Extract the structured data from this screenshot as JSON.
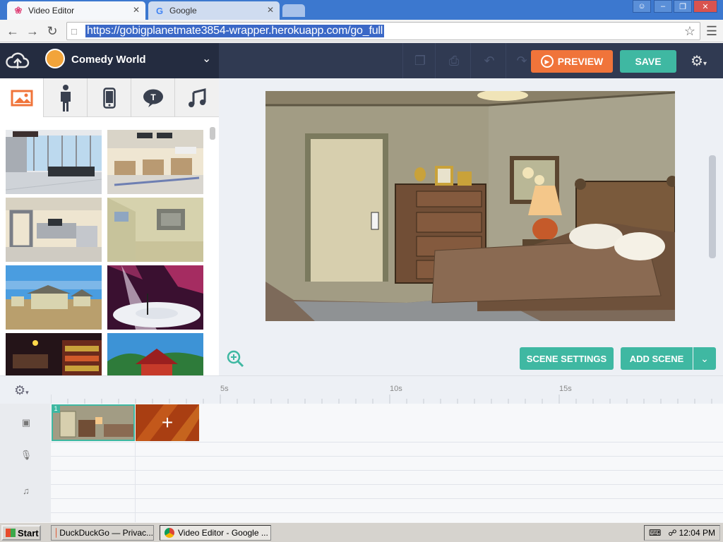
{
  "browser": {
    "tabs": [
      {
        "title": "Video Editor",
        "active": true
      },
      {
        "title": "Google",
        "active": false
      }
    ],
    "url": "https://gobigplanetmate3854-wrapper.herokuapp.com/go_full"
  },
  "editor": {
    "project_title": "Comedy World",
    "preview_label": "PREVIEW",
    "save_label": "SAVE",
    "library_tabs": [
      "backgrounds-icon",
      "character-icon",
      "phone-icon",
      "text-bubble-icon",
      "music-icon"
    ],
    "active_library_tab": 0,
    "scene_settings_label": "SCENE SETTINGS",
    "add_scene_label": "ADD SCENE"
  },
  "timeline": {
    "tick_labels": [
      "5s",
      "10s",
      "15s"
    ],
    "scene_number": "1",
    "tracks": [
      "camera-icon",
      "mic-icon",
      "music-icon"
    ]
  },
  "taskbar": {
    "start_label": "Start",
    "tasks": [
      "DuckDuckGo — Privac...",
      "Video Editor - Google ..."
    ],
    "clock": "12:04 PM"
  },
  "colors": {
    "accent_orange": "#f0743a",
    "accent_teal": "#3fb8a2",
    "appbar": "#303a52"
  }
}
